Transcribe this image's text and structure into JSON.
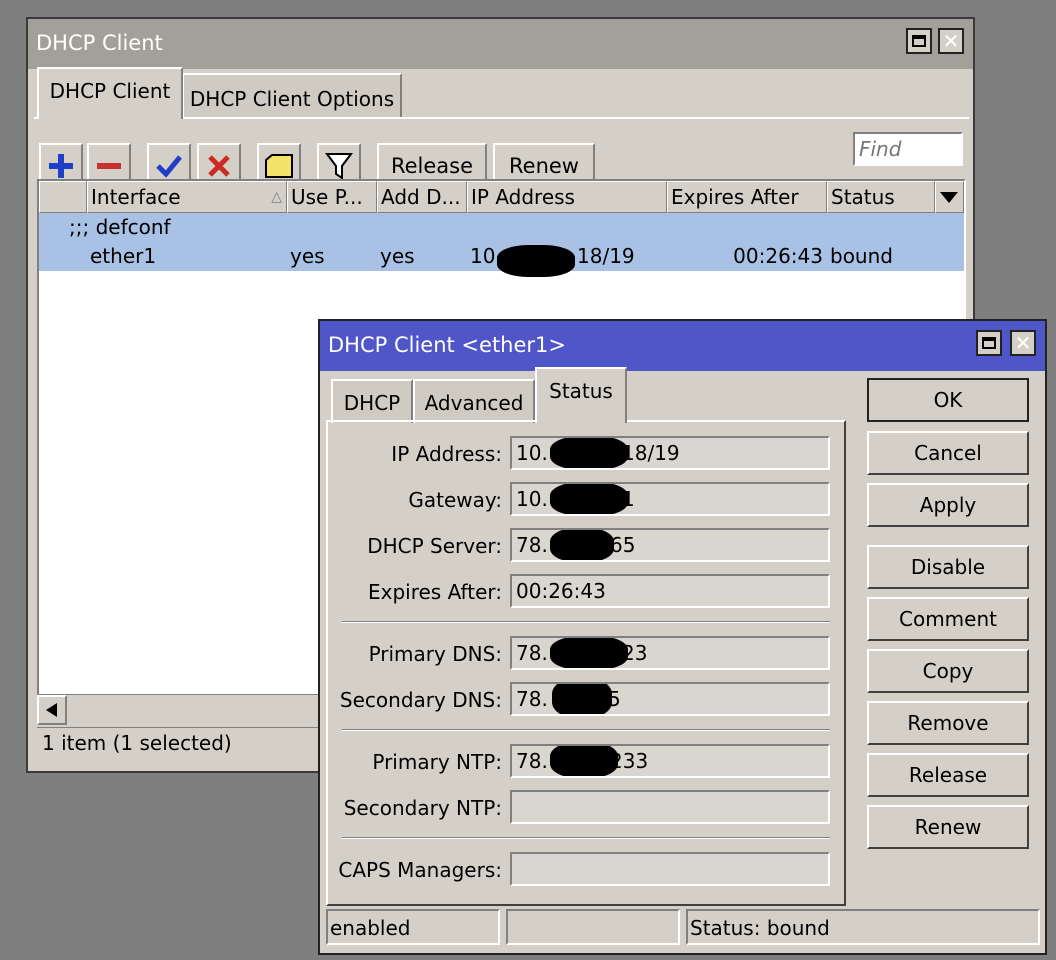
{
  "main_window": {
    "title": "DHCP Client",
    "tabs": [
      {
        "label": "DHCP Client",
        "active": true
      },
      {
        "label": "DHCP Client Options",
        "active": false
      }
    ],
    "toolbar": {
      "release_label": "Release",
      "renew_label": "Renew",
      "find_placeholder": "Find"
    },
    "table": {
      "columns": [
        "Interface",
        "Use P...",
        "Add D...",
        "IP Address",
        "Expires After",
        "Status"
      ],
      "comment": ";;; defconf",
      "rows": [
        {
          "interface": "ether1",
          "use_peer": "yes",
          "add_default": "yes",
          "ip_prefix": "10",
          "ip_suffix": "18/19",
          "expires_after": "00:26:43",
          "status": "bound"
        }
      ]
    },
    "status_text": "1 item (1 selected)"
  },
  "dialog": {
    "title": "DHCP Client <ether1>",
    "tabs": [
      {
        "label": "DHCP",
        "active": false
      },
      {
        "label": "Advanced",
        "active": false
      },
      {
        "label": "Status",
        "active": true
      }
    ],
    "fields": {
      "ip_address": {
        "label": "IP Address:",
        "prefix": "10.",
        "suffix": "18/19"
      },
      "gateway": {
        "label": "Gateway:",
        "prefix": "10.",
        "suffix": "1"
      },
      "dhcp_server": {
        "label": "DHCP Server:",
        "prefix": "78.",
        "suffix": "65"
      },
      "expires_after": {
        "label": "Expires After:",
        "value": "00:26:43"
      },
      "primary_dns": {
        "label": "Primary DNS:",
        "prefix": "78.",
        "suffix": "23"
      },
      "secondary_dns": {
        "label": "Secondary DNS:",
        "prefix": "78.",
        "suffix": "5"
      },
      "primary_ntp": {
        "label": "Primary NTP:",
        "prefix": "78.",
        "suffix": "233"
      },
      "secondary_ntp": {
        "label": "Secondary NTP:",
        "value": ""
      },
      "caps_managers": {
        "label": "CAPS Managers:",
        "value": ""
      }
    },
    "buttons": {
      "ok": "OK",
      "cancel": "Cancel",
      "apply": "Apply",
      "disable": "Disable",
      "comment": "Comment",
      "copy": "Copy",
      "remove": "Remove",
      "release": "Release",
      "renew": "Renew"
    },
    "statusbar": {
      "left": "enabled",
      "middle": "",
      "right": "Status: bound"
    }
  },
  "colors": {
    "desktop": "#7f7f7f",
    "window_face": "#d4d0c8",
    "inactive_title": "#a3a09a",
    "active_title": "#4e56c8",
    "selection": "#a9c1e4",
    "add_icon": "#1f3fc8",
    "remove_icon": "#c8322e",
    "enable_icon": "#1f3fc8",
    "disable_icon": "#cc2a24",
    "comment_icon": "#f4e36a"
  },
  "icons": [
    "plus-icon",
    "minus-icon",
    "check-icon",
    "x-icon",
    "note-icon",
    "filter-icon",
    "sort-asc-icon",
    "column-dropdown-icon",
    "scroll-left-icon",
    "maximize-icon",
    "close-icon"
  ]
}
